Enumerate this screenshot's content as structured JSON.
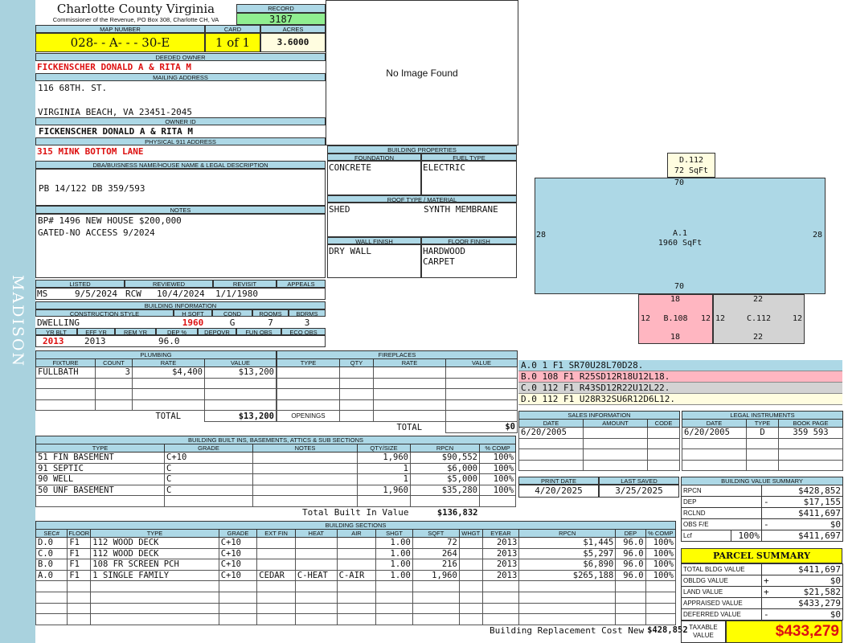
{
  "sidebar": {
    "label": "MADISON"
  },
  "header": {
    "county": "Charlotte County Virginia",
    "commissioner": "Commissioner of the Revenue, PO Box 308, Charlotte CH, VA",
    "record_label": "RECORD",
    "record": "3187",
    "map_label": "MAP NUMBER",
    "map_number": "028- - A- - - 30-E",
    "card_label": "CARD",
    "card": "1 of 1",
    "acres_label": "ACRES",
    "acres": "3.6000"
  },
  "owner": {
    "deeded_label": "DEEDED OWNER",
    "deeded": "FICKENSCHER DONALD A & RITA M",
    "mailing_label": "MAILING ADDRESS",
    "mail1": "116 68TH. ST.",
    "mail2": "VIRGINIA BEACH, VA 23451-2045",
    "owner_id_label": "OWNER ID",
    "owner_id": "FICKENSCHER DONALD A & RITA M",
    "phys_label": "PHYSICAL 911 ADDRESS",
    "physical": "315 MINK BOTTOM LANE",
    "dba_label": "DBA/BUISNESS NAME/HOUSE NAME & LEGAL DESCRIPTION",
    "legal": "PB 14/122 DB 359/593",
    "notes_label": "NOTES",
    "note1": "BP# 1496 NEW HOUSE $200,000",
    "note2": "GATED-NO ACCESS 9/2024"
  },
  "photo": {
    "text": "No Image Found"
  },
  "building_props": {
    "label": "BUILDING PROPERTIES",
    "foundation_label": "FOUNDATION",
    "foundation": "CONCRETE",
    "fuel_label": "FUEL TYPE",
    "fuel": "ELECTRIC",
    "roof_label": "ROOF TYPE / MATERIAL",
    "roof_type": "SHED",
    "roof_material": "SYNTH MEMBRANE",
    "wall_label": "WALL FINISH",
    "wall": "DRY WALL",
    "floor_label": "FLOOR FINISH",
    "floor1": "HARDWOOD",
    "floor2": "CARPET"
  },
  "review": {
    "listed_label": "LISTED",
    "listed_by": "MS",
    "listed": "9/5/2024",
    "reviewed_label": "REVIEWED",
    "reviewed_by": "RCW",
    "reviewed": "10/4/2024",
    "revisit_label": "REVISIT",
    "revisit": "1/1/1980",
    "appeals_label": "APPEALS"
  },
  "bldg_info": {
    "label": "BUILDING INFORMATION",
    "style_label": "CONSTRUCTION STYLE",
    "style": "DWELLING",
    "hsqft_label": "H SQFT",
    "hsqft": "1960",
    "cond_label": "COND",
    "cond": "G",
    "rooms_label": "ROOMS",
    "rooms": "7",
    "bdrms_label": "BDRMS",
    "bdrms": "3",
    "yrblt_label": "YR BLT",
    "yrblt": "2013",
    "effyr_label": "EFF YR",
    "effyr": "2013",
    "remyr_label": "REM YR",
    "dep_label": "DEP %",
    "dep": "96.0",
    "depovr_label": "DEPOVR",
    "funobs_label": "FUN OBS",
    "ecoobs_label": "ECO OBS"
  },
  "plumbing": {
    "label": "PLUMBING",
    "headers": [
      "FIXTURE",
      "COUNT",
      "RATE",
      "VALUE"
    ],
    "rows": [
      [
        "FULLBATH",
        "3",
        "$4,400",
        "$13,200"
      ]
    ],
    "total_label": "TOTAL",
    "total": "$13,200"
  },
  "fireplaces": {
    "label": "FIREPLACES",
    "headers": [
      "TYPE",
      "QTY",
      "RATE",
      "VALUE"
    ],
    "openings_label": "OPENINGS",
    "total_label": "TOTAL",
    "total": "$0"
  },
  "builtins": {
    "label": "BUILDING BUILT INS, BASEMENTS, ATTICS & SUB SECTIONS",
    "headers": [
      "TYPE",
      "GRADE",
      "NOTES",
      "QTY/SIZE",
      "RPCN",
      "% COMP"
    ],
    "rows": [
      [
        "51 FIN BASEMENT",
        "C+10",
        "",
        "1,960",
        "$90,552",
        "100%"
      ],
      [
        "91 SEPTIC",
        "C",
        "",
        "1",
        "$6,000",
        "100%"
      ],
      [
        "90 WELL",
        "C",
        "",
        "1",
        "$5,000",
        "100%"
      ],
      [
        "50 UNF BASEMENT",
        "C",
        "",
        "1,960",
        "$35,280",
        "100%"
      ]
    ],
    "total_label": "Total Built In Value",
    "total": "$136,832"
  },
  "sections": {
    "label": "BUILDING SECTIONS",
    "headers": [
      "SEC#",
      "FLOOR",
      "TYPE",
      "GRADE",
      "EXT FIN",
      "HEAT",
      "AIR",
      "SHGT",
      "SQFT",
      "WHGT",
      "EYEAR",
      "RPCN",
      "DEP",
      "% COMP"
    ],
    "rows": [
      [
        "D.0",
        "F1",
        "112 WOOD DECK",
        "C+10",
        "",
        "",
        "",
        "1.00",
        "72",
        "",
        "2013",
        "$1,445",
        "96.0",
        "100%"
      ],
      [
        "C.0",
        "F1",
        "112 WOOD DECK",
        "C+10",
        "",
        "",
        "",
        "1.00",
        "264",
        "",
        "2013",
        "$5,297",
        "96.0",
        "100%"
      ],
      [
        "B.0",
        "F1",
        "108 FR SCREEN PCH",
        "C+10",
        "",
        "",
        "",
        "1.00",
        "216",
        "",
        "2013",
        "$6,890",
        "96.0",
        "100%"
      ],
      [
        "A.0",
        "F1",
        "1 SINGLE FAMILY",
        "C+10",
        "CEDAR",
        "C-HEAT",
        "C-AIR",
        "1.00",
        "1,960",
        "",
        "2013",
        "$265,188",
        "96.0",
        "100%"
      ]
    ],
    "total_label": "Building Replacement Cost New",
    "total": "$428,852"
  },
  "sketch": {
    "d_label": "D.112",
    "d_area": "72 SqFt",
    "a_label": "A.1",
    "a_area": "1960 SqFt",
    "b_label": "B.108",
    "c_label": "C.112",
    "dims": {
      "a_top": "70",
      "a_bottom": "70",
      "a_left": "28",
      "a_right": "28",
      "b_top": "18",
      "b_bottom": "18",
      "b_left": "12",
      "b_right": "12",
      "c_top": "22",
      "c_bottom": "22",
      "c_left": "12",
      "c_right": "12"
    }
  },
  "vectors": [
    {
      "text": "A.0 1 F1 SR70U28L70D28.",
      "color": "#add8e6"
    },
    {
      "text": "B.0 108 F1 R25SD12R18U12L18.",
      "color": "#ffb6c1"
    },
    {
      "text": "C.0 112 F1 R43SD12R22U12L22.",
      "color": "#d3d3d3"
    },
    {
      "text": "D.0 112 F1 U28R32SU6R12D6L12.",
      "color": "#fffde0"
    }
  ],
  "sales": {
    "label": "SALES INFORMATION",
    "headers": [
      "DATE",
      "AMOUNT",
      "CODE"
    ],
    "rows": [
      [
        "6/20/2005",
        "",
        ""
      ]
    ]
  },
  "legal_inst": {
    "label": "LEGAL INSTRUMENTS",
    "headers": [
      "DATE",
      "TYPE",
      "BOOK PAGE"
    ],
    "rows": [
      [
        "6/20/2005",
        "D",
        "359 593"
      ]
    ]
  },
  "dates": {
    "print_label": "PRINT DATE",
    "print": "4/20/2025",
    "saved_label": "LAST SAVED",
    "saved": "3/25/2025"
  },
  "bvs": {
    "label": "BUILDING VALUE SUMMARY",
    "rpcn_label": "RPCN",
    "rpcn": "$428,852",
    "dep_label": "DEP",
    "dep_sign": "-",
    "dep": "$17,155",
    "rclnd_label": "RCLND",
    "rclnd": "$411,697",
    "obs_label": "OBS F/E",
    "obs_sign": "-",
    "obs": "$0",
    "lcf_label": "Lcf",
    "lcf_pct": "100%",
    "lcf": "$411,697"
  },
  "parcel": {
    "label": "PARCEL SUMMARY",
    "bldg_label": "TOTAL BLDG VALUE",
    "bldg": "$411,697",
    "obldg_label": "OBLDG VALUE",
    "obldg_sign": "+",
    "obldg": "$0",
    "land_label": "LAND VALUE",
    "land_sign": "+",
    "land": "$21,582",
    "appr_label": "APPRAISED VALUE",
    "appr": "$433,279",
    "def_label": "DEFERRED VALUE",
    "def_sign": "-",
    "def": "$0",
    "tax_label1": "TAXABLE",
    "tax_label2": "VALUE",
    "taxable": "$433,279"
  }
}
